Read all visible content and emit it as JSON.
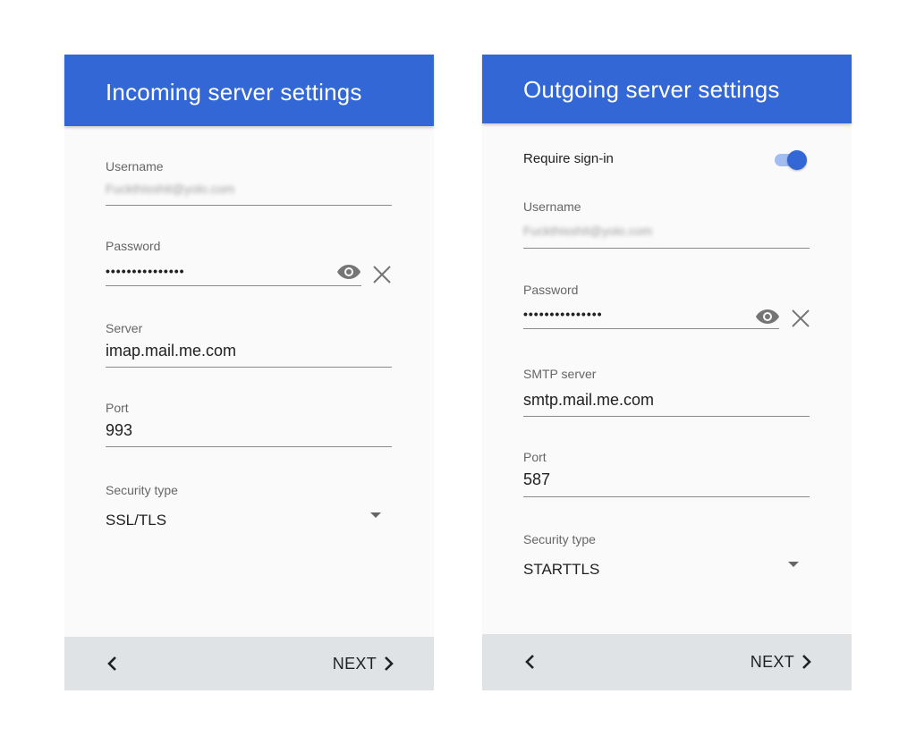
{
  "incoming": {
    "title": "Incoming server settings",
    "username": {
      "label": "Username",
      "value": "Fuckthisshit@yolo.com"
    },
    "password": {
      "label": "Password",
      "value": "•••••••••••••••"
    },
    "server": {
      "label": "Server",
      "value": "imap.mail.me.com"
    },
    "port": {
      "label": "Port",
      "value": "993"
    },
    "security": {
      "label": "Security type",
      "value": "SSL/TLS"
    },
    "footer": {
      "next_label": "NEXT"
    }
  },
  "outgoing": {
    "title": "Outgoing server settings",
    "require_signin": {
      "label": "Require sign-in",
      "enabled": true
    },
    "username": {
      "label": "Username",
      "value": "Fuckthisshit@yolo.com"
    },
    "password": {
      "label": "Password",
      "value": "•••••••••••••••"
    },
    "server": {
      "label": "SMTP server",
      "value": "smtp.mail.me.com"
    },
    "port": {
      "label": "Port",
      "value": "587"
    },
    "security": {
      "label": "Security type",
      "value": "STARTTLS"
    },
    "footer": {
      "next_label": "NEXT"
    }
  },
  "colors": {
    "app_bar": "#3367d6",
    "toggle_knob": "#3367d6",
    "toggle_track": "#a4bdf0",
    "footer": "#e0e3e6",
    "panel": "#fafafa"
  },
  "icons": [
    "eye-icon",
    "close-icon",
    "chevron-left-icon",
    "chevron-right-icon",
    "dropdown-arrow-icon"
  ]
}
